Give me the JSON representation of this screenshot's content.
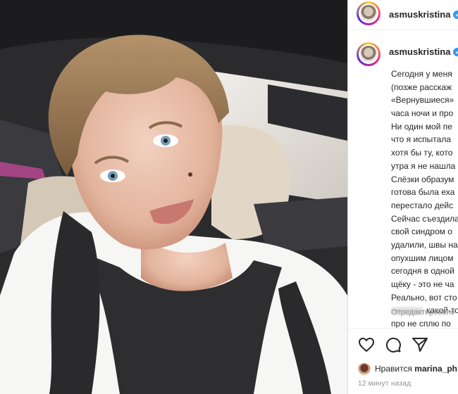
{
  "post": {
    "author": "asmuskristina",
    "verified_icon": "verified-badge-icon",
    "caption_lines": [
      "Сегодня у меня",
      "(позже расскаж",
      "«Вернувшиеся»",
      "часа ночи и про",
      "Ни один мой пе",
      "что я испытала",
      "хотя бы ту, кото",
      "утра я не нашла",
      "Слёзки образум",
      "готова была еха",
      "перестало дейс",
      "Сейчас съездила",
      "свой синдром о",
      "удалили, швы на",
      "опухшим лицом",
      "сегодня в одной",
      "щёку - это не ча",
      "Реально, вот сто"
    ],
    "caption_line_blurred_suffix": "какой-то",
    "caption_last_line": "про не сплю по",
    "edited_label": "Отредактировано",
    "likes_prefix": "Нравится",
    "likes_user": "marina_ph",
    "timestamp": "12 минут назад"
  },
  "icons": {
    "like": "heart-icon",
    "comment": "comment-icon",
    "share": "share-icon"
  },
  "colors": {
    "verified": "#3897f0",
    "text": "#262626",
    "muted": "#8e8e8e"
  }
}
